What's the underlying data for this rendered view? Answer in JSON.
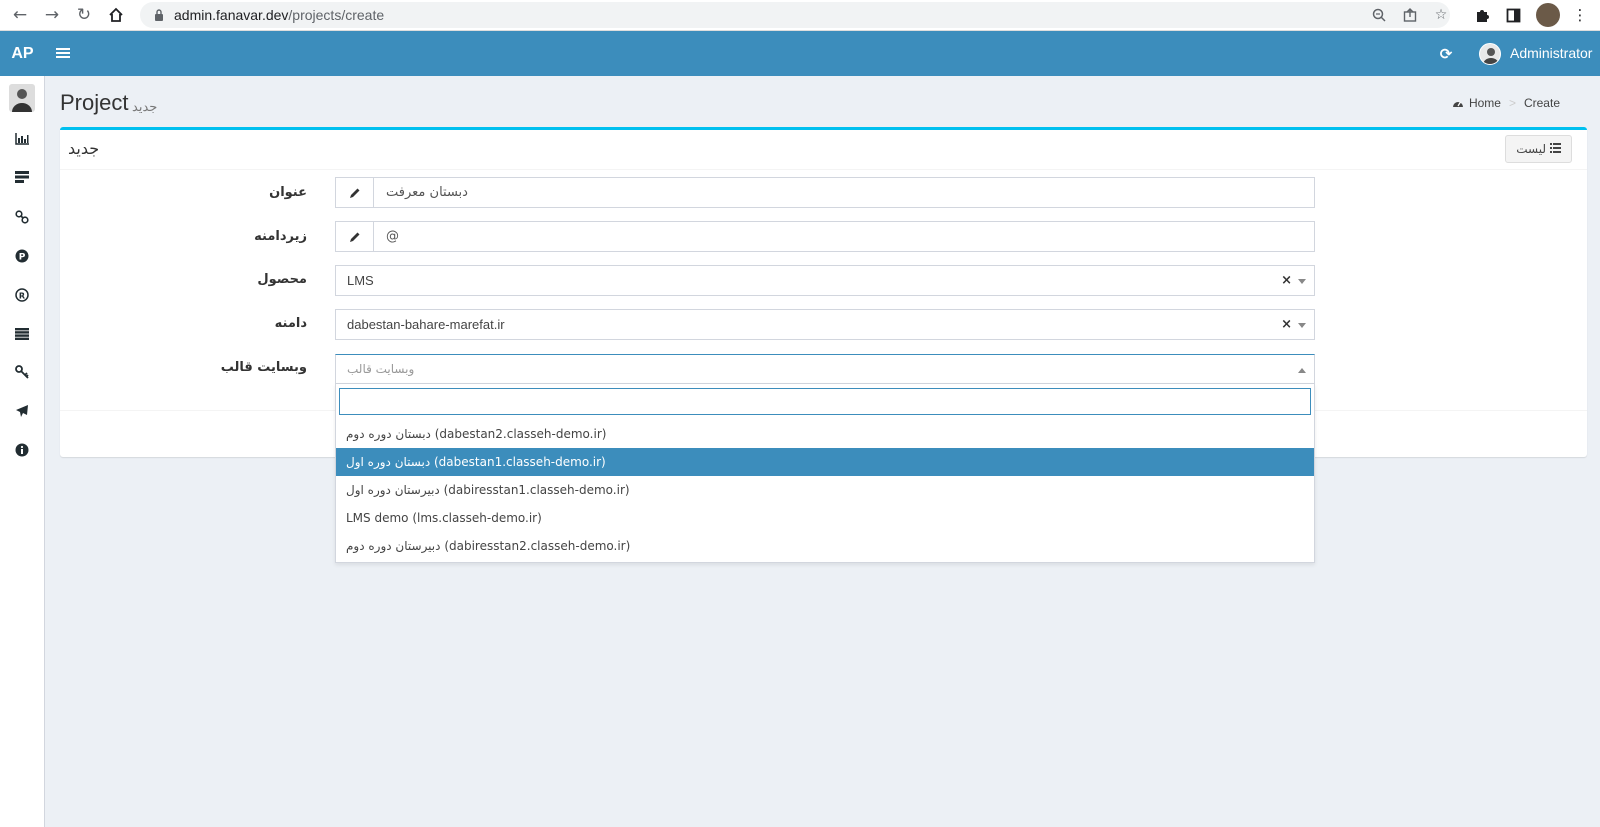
{
  "browser": {
    "url_host": "admin.fanavar.dev",
    "url_path": "/projects/create"
  },
  "header": {
    "logo": "AP",
    "user_name": "Administrator"
  },
  "page": {
    "title": "Project",
    "subtitle": "جدید",
    "breadcrumb": [
      "Home",
      "Create"
    ]
  },
  "box": {
    "title": "جدید",
    "list_button": "لیست"
  },
  "form": {
    "title_label": "عنوان",
    "title_value": "دبستان معرفت",
    "subdomain_label": "زیردامنه",
    "subdomain_value": "@",
    "product_label": "محصول",
    "product_value": "LMS",
    "domain_label": "دامنه",
    "domain_value": "dabestan-bahare-marefat.ir",
    "template_label": "وبسایت قالب",
    "template_placeholder": "وبسایت قالب",
    "clear_symbol": "×"
  },
  "dropdown": {
    "search_value": "",
    "options": [
      "دبستان دوره دوم (dabestan2.classeh-demo.ir)",
      "دبستان دوره اول (dabestan1.classeh-demo.ir)",
      "دبیرستان دوره اول (dabiresstan1.classeh-demo.ir)",
      "LMS demo (lms.classeh-demo.ir)",
      "دبیرستان دوره دوم (dabiresstan2.classeh-demo.ir)"
    ],
    "highlighted_index": 1
  },
  "icons": {
    "sidebar": [
      "bar-chart-icon",
      "list-icon",
      "link-icon",
      "parking-icon",
      "registered-icon",
      "table-icon",
      "key-icon",
      "plane-icon",
      "info-icon"
    ]
  },
  "colors": {
    "primary": "#3c8dbc",
    "box_top_border": "#00c0ef",
    "background": "#ecf0f5"
  }
}
